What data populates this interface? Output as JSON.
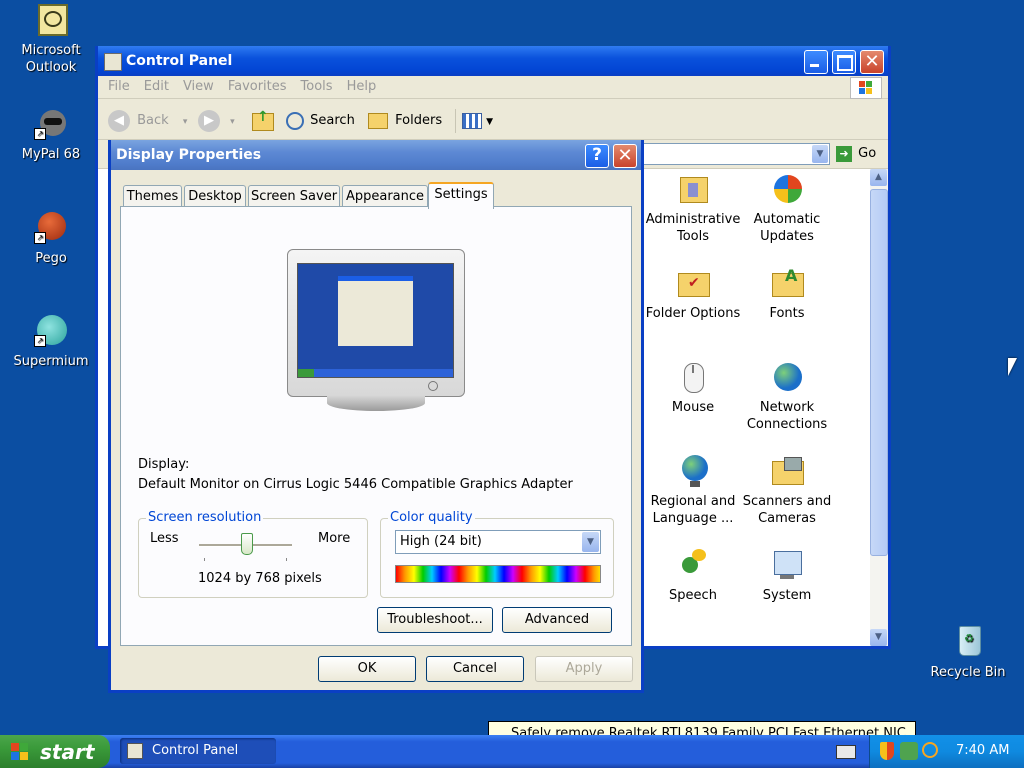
{
  "desktop": {
    "icons": [
      {
        "label_lines": [
          "Microsoft",
          "Outlook"
        ]
      },
      {
        "label_lines": [
          "MyPal 68"
        ]
      },
      {
        "label_lines": [
          "Pego"
        ]
      },
      {
        "label_lines": [
          "Supermium"
        ]
      },
      {
        "label_lines": [
          "Recycle Bin"
        ]
      }
    ]
  },
  "control_panel": {
    "title": "Control Panel",
    "menu": [
      "File",
      "Edit",
      "View",
      "Favorites",
      "Tools",
      "Help"
    ],
    "toolbar": {
      "back": "Back",
      "search": "Search",
      "folders": "Folders"
    },
    "go": "Go",
    "items": [
      {
        "lines": [
          "Administrative",
          "Tools"
        ],
        "icon": "administrative-tools-icon"
      },
      {
        "lines": [
          "Automatic",
          "Updates"
        ],
        "icon": "automatic-updates-icon"
      },
      {
        "lines": [
          "Folder Options"
        ],
        "icon": "folder-options-icon"
      },
      {
        "lines": [
          "Fonts"
        ],
        "icon": "fonts-icon"
      },
      {
        "lines": [
          "Mouse"
        ],
        "icon": "mouse-icon"
      },
      {
        "lines": [
          "Network",
          "Connections"
        ],
        "icon": "network-connections-icon"
      },
      {
        "lines": [
          "Regional and",
          "Language ..."
        ],
        "icon": "regional-language-icon"
      },
      {
        "lines": [
          "Scanners and",
          "Cameras"
        ],
        "icon": "scanners-cameras-icon"
      },
      {
        "lines": [
          "Speech"
        ],
        "icon": "speech-icon"
      },
      {
        "lines": [
          "System"
        ],
        "icon": "system-icon"
      }
    ]
  },
  "display_properties": {
    "title": "Display Properties",
    "tabs": [
      "Themes",
      "Desktop",
      "Screen Saver",
      "Appearance",
      "Settings"
    ],
    "active_tab": "Settings",
    "display_label": "Display:",
    "display_value": "Default Monitor on Cirrus Logic 5446 Compatible Graphics Adapter",
    "resolution": {
      "legend": "Screen resolution",
      "less": "Less",
      "more": "More",
      "value": "1024 by 768 pixels",
      "slider_fraction": 0.5
    },
    "color_quality": {
      "legend": "Color quality",
      "selected": "High (24 bit)"
    },
    "buttons": {
      "troubleshoot": "Troubleshoot...",
      "advanced": "Advanced",
      "ok": "OK",
      "cancel": "Cancel",
      "apply": "Apply"
    }
  },
  "taskbar": {
    "start": "start",
    "task": "Control Panel",
    "clock": "7:40 AM",
    "balloon": "Safely remove Realtek RTL8139 Family PCI Fast Ethernet NIC"
  },
  "colors": {
    "desktop": "#0b4ea2",
    "titlebar": "#0a52dc",
    "start_green": "#3a9a3a",
    "tray_blue": "#0f8ae0"
  }
}
